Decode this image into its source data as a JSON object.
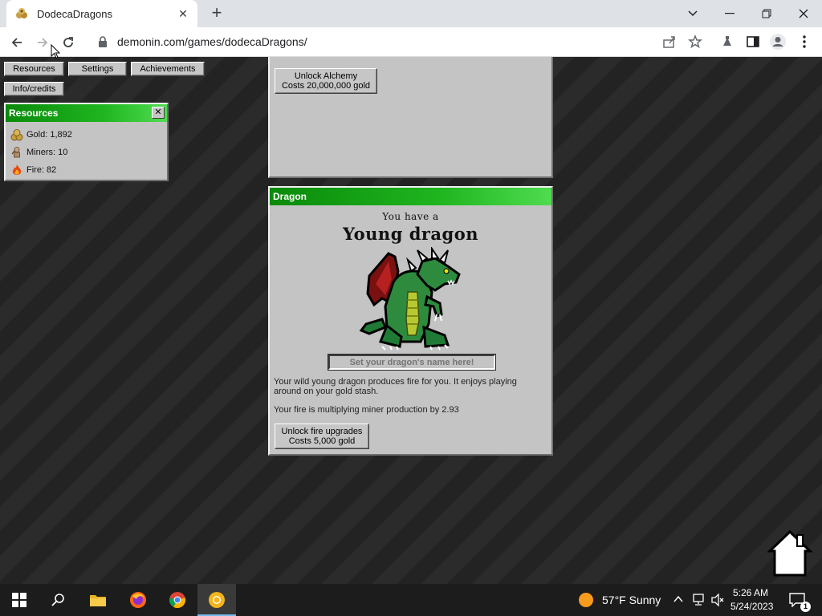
{
  "browser": {
    "tab_title": "DodecaDragons",
    "new_tab_symbol": "+",
    "url": "demonin.com/games/dodecaDragons/",
    "icons": [
      "back-icon",
      "forward-icon",
      "reload-icon",
      "lock-icon",
      "share-icon",
      "star-icon",
      "extensions-icon",
      "sidepanel-icon",
      "profile-icon",
      "menu-icon"
    ]
  },
  "menu": {
    "resources": "Resources",
    "settings": "Settings",
    "achievements": "Achievements",
    "info": "Info/credits"
  },
  "resources_panel": {
    "title": "Resources",
    "close": "✕",
    "items": [
      {
        "label": "Gold: 1,892",
        "icon": "gold-icon"
      },
      {
        "label": "Miners: 10",
        "icon": "miner-icon"
      },
      {
        "label": "Fire: 82",
        "icon": "fire-icon"
      }
    ]
  },
  "alchemy_panel": {
    "button_line1": "Unlock Alchemy",
    "button_line2": "Costs 20,000,000 gold"
  },
  "dragon_panel": {
    "title": "Dragon",
    "you_have": "You have a",
    "dragon_type": "Young dragon",
    "name_placeholder": "Set your dragon's name here!",
    "description": "Your wild young dragon produces fire for you. It enjoys playing around on your gold stash.",
    "multiplier": "Your fire is multiplying miner production by 2.93",
    "button_line1": "Unlock fire upgrades",
    "button_line2": "Costs 5,000 gold"
  },
  "taskbar": {
    "weather": "57°F  Sunny",
    "time": "5:26 AM",
    "date": "5/24/2023",
    "notification_count": "1",
    "apps": [
      "start-icon",
      "search-icon",
      "file-explorer-icon",
      "firefox-icon",
      "chrome-icon",
      "chrome-canary-icon"
    ]
  },
  "colors": {
    "panel_header": "#1fb51f",
    "panel_bg": "#c4c4c4",
    "page_bg": "#262626"
  }
}
